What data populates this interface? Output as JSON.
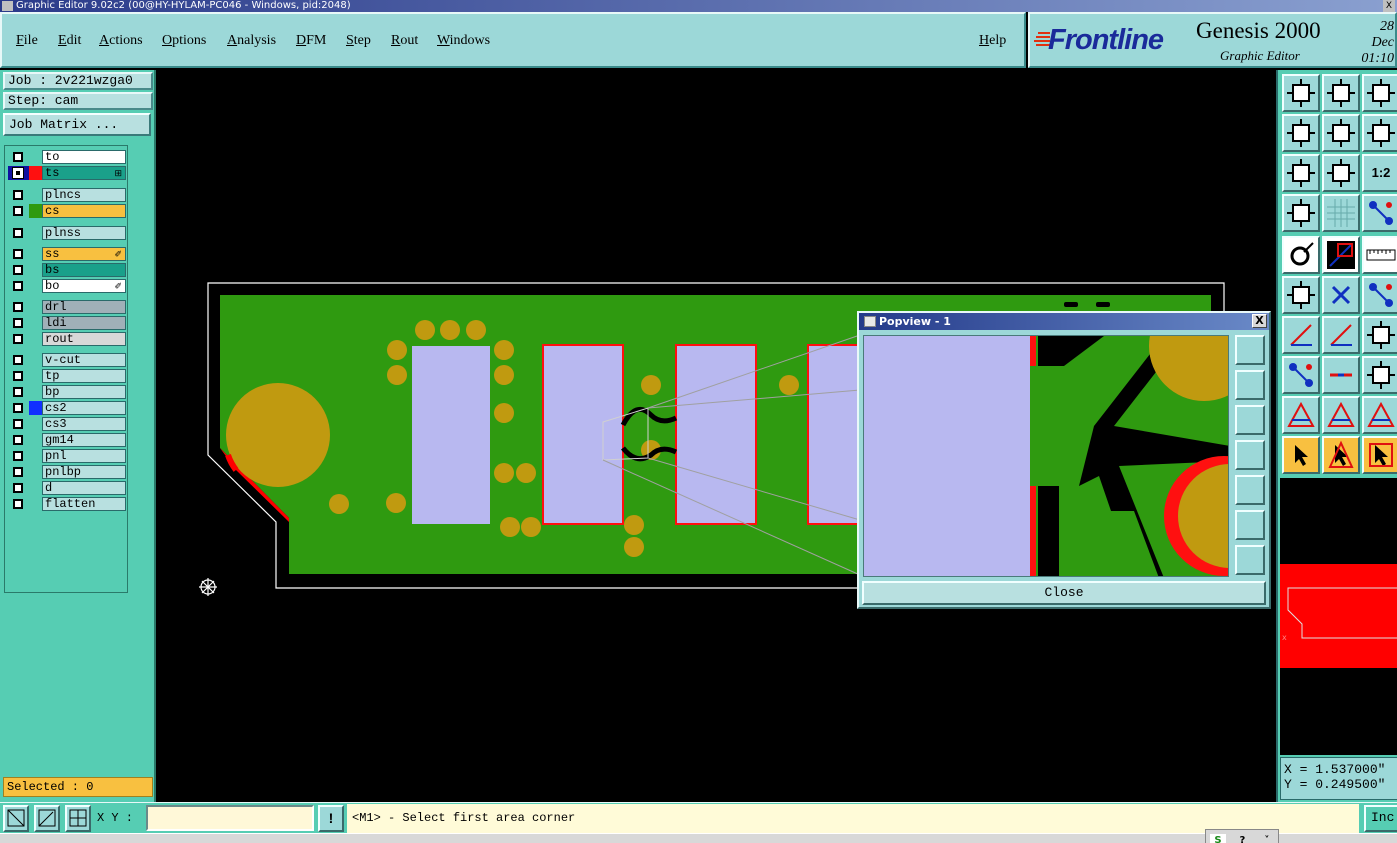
{
  "window": {
    "title": "Graphic Editor 9.02c2 (00@HY-HYLAM-PC046 - Windows, pid:2048)",
    "close": "X"
  },
  "menu": {
    "file": "File",
    "edit": "Edit",
    "actions": "Actions",
    "options": "Options",
    "analysis": "Analysis",
    "dfm": "DFM",
    "step": "Step",
    "rout": "Rout",
    "windows": "Windows",
    "help": "Help"
  },
  "brand": {
    "logo": "Frontline",
    "product": "Genesis 2000",
    "subtitle": "Graphic Editor",
    "date": "28 Dec",
    "time": "01:10"
  },
  "job": {
    "job_label": "Job : 2v221wzga0",
    "step_label": "Step: cam",
    "matrix_button": "Job Matrix ..."
  },
  "layers": [
    {
      "name": "to",
      "bg": "#ffffff",
      "swatch": "",
      "marker": ""
    },
    {
      "name": "ts",
      "bg": "#1aa08a",
      "swatch": "#ff1010",
      "marker": "⊞",
      "active": true
    },
    {
      "name": "plncs",
      "bg": "#b8e0e0",
      "swatch": "",
      "marker": ""
    },
    {
      "name": "cs",
      "bg": "#f8c040",
      "swatch": "#2f9a10",
      "marker": ""
    },
    {
      "name": "plnss",
      "bg": "#b8e0e0",
      "swatch": "",
      "marker": ""
    },
    {
      "name": "ss",
      "bg": "#f8c040",
      "swatch": "",
      "marker": "✐"
    },
    {
      "name": "bs",
      "bg": "#1aa08a",
      "swatch": "",
      "marker": ""
    },
    {
      "name": "bo",
      "bg": "#ffffff",
      "swatch": "",
      "marker": "✐"
    },
    {
      "name": "drl",
      "bg": "#a0b0b8",
      "swatch": "",
      "marker": ""
    },
    {
      "name": "ldi",
      "bg": "#a0b0b8",
      "swatch": "",
      "marker": ""
    },
    {
      "name": "rout",
      "bg": "#d8d8d8",
      "swatch": "",
      "marker": ""
    },
    {
      "name": "v-cut",
      "bg": "#b8e0e0",
      "swatch": "",
      "marker": ""
    },
    {
      "name": "tp",
      "bg": "#b8e0e0",
      "swatch": "",
      "marker": ""
    },
    {
      "name": "bp",
      "bg": "#b8e0e0",
      "swatch": "",
      "marker": ""
    },
    {
      "name": "cs2",
      "bg": "#b8e0e0",
      "swatch": "#1030ff",
      "marker": ""
    },
    {
      "name": "cs3",
      "bg": "#b8e0e0",
      "swatch": "",
      "marker": ""
    },
    {
      "name": "gm14",
      "bg": "#b8e0e0",
      "swatch": "",
      "marker": ""
    },
    {
      "name": "pnl",
      "bg": "#b8e0e0",
      "swatch": "",
      "marker": ""
    },
    {
      "name": "pnlbp",
      "bg": "#b8e0e0",
      "swatch": "",
      "marker": ""
    },
    {
      "name": "d",
      "bg": "#b8e0e0",
      "swatch": "",
      "marker": ""
    },
    {
      "name": "flatten",
      "bg": "#b8e0e0",
      "swatch": "",
      "marker": ""
    }
  ],
  "selected": "Selected : 0",
  "popview": {
    "title": "Popview - 1",
    "close_x": "X",
    "close_button": "Close"
  },
  "coords": {
    "x": "X = 1.537000\"",
    "y": "Y = 0.249500\""
  },
  "toolbar_icons": [
    "zoom-home-icon",
    "zoom-fit-icon",
    "home-icon",
    "pan-left-icon",
    "pan-right-icon",
    "undo-view-icon",
    "fit-screen-icon",
    "center-icon",
    "scale-1-2-icon",
    "settings-icon",
    "grid-icon",
    "net-icon",
    "snap-icon",
    "measure-icon",
    "ruler-icon",
    "select-icon",
    "cross-icon",
    "connect-icon",
    "angle-icon",
    "line-icon",
    "rotate-icon",
    "pad-icon",
    "dash-icon",
    "box-icon",
    "triangle-icon",
    "triangle-up-icon",
    "triangle-outline-icon",
    "pointer-icon",
    "pointer-box-icon",
    "pointer-circle-icon"
  ],
  "toolbar_labels": {
    "scale": "1:2"
  },
  "bottom": {
    "xy_label": "X Y :",
    "xy_value": "",
    "warn": "!",
    "message": "<M1> - Select first area corner",
    "inc": "Inc"
  },
  "colors": {
    "board": "#2f9a10",
    "pad": "#c09a10",
    "copper": "#b8b8f0",
    "outline": "#ff0000",
    "panel_bg": "#56cdb3",
    "menu_bg": "#9cd8d8"
  }
}
